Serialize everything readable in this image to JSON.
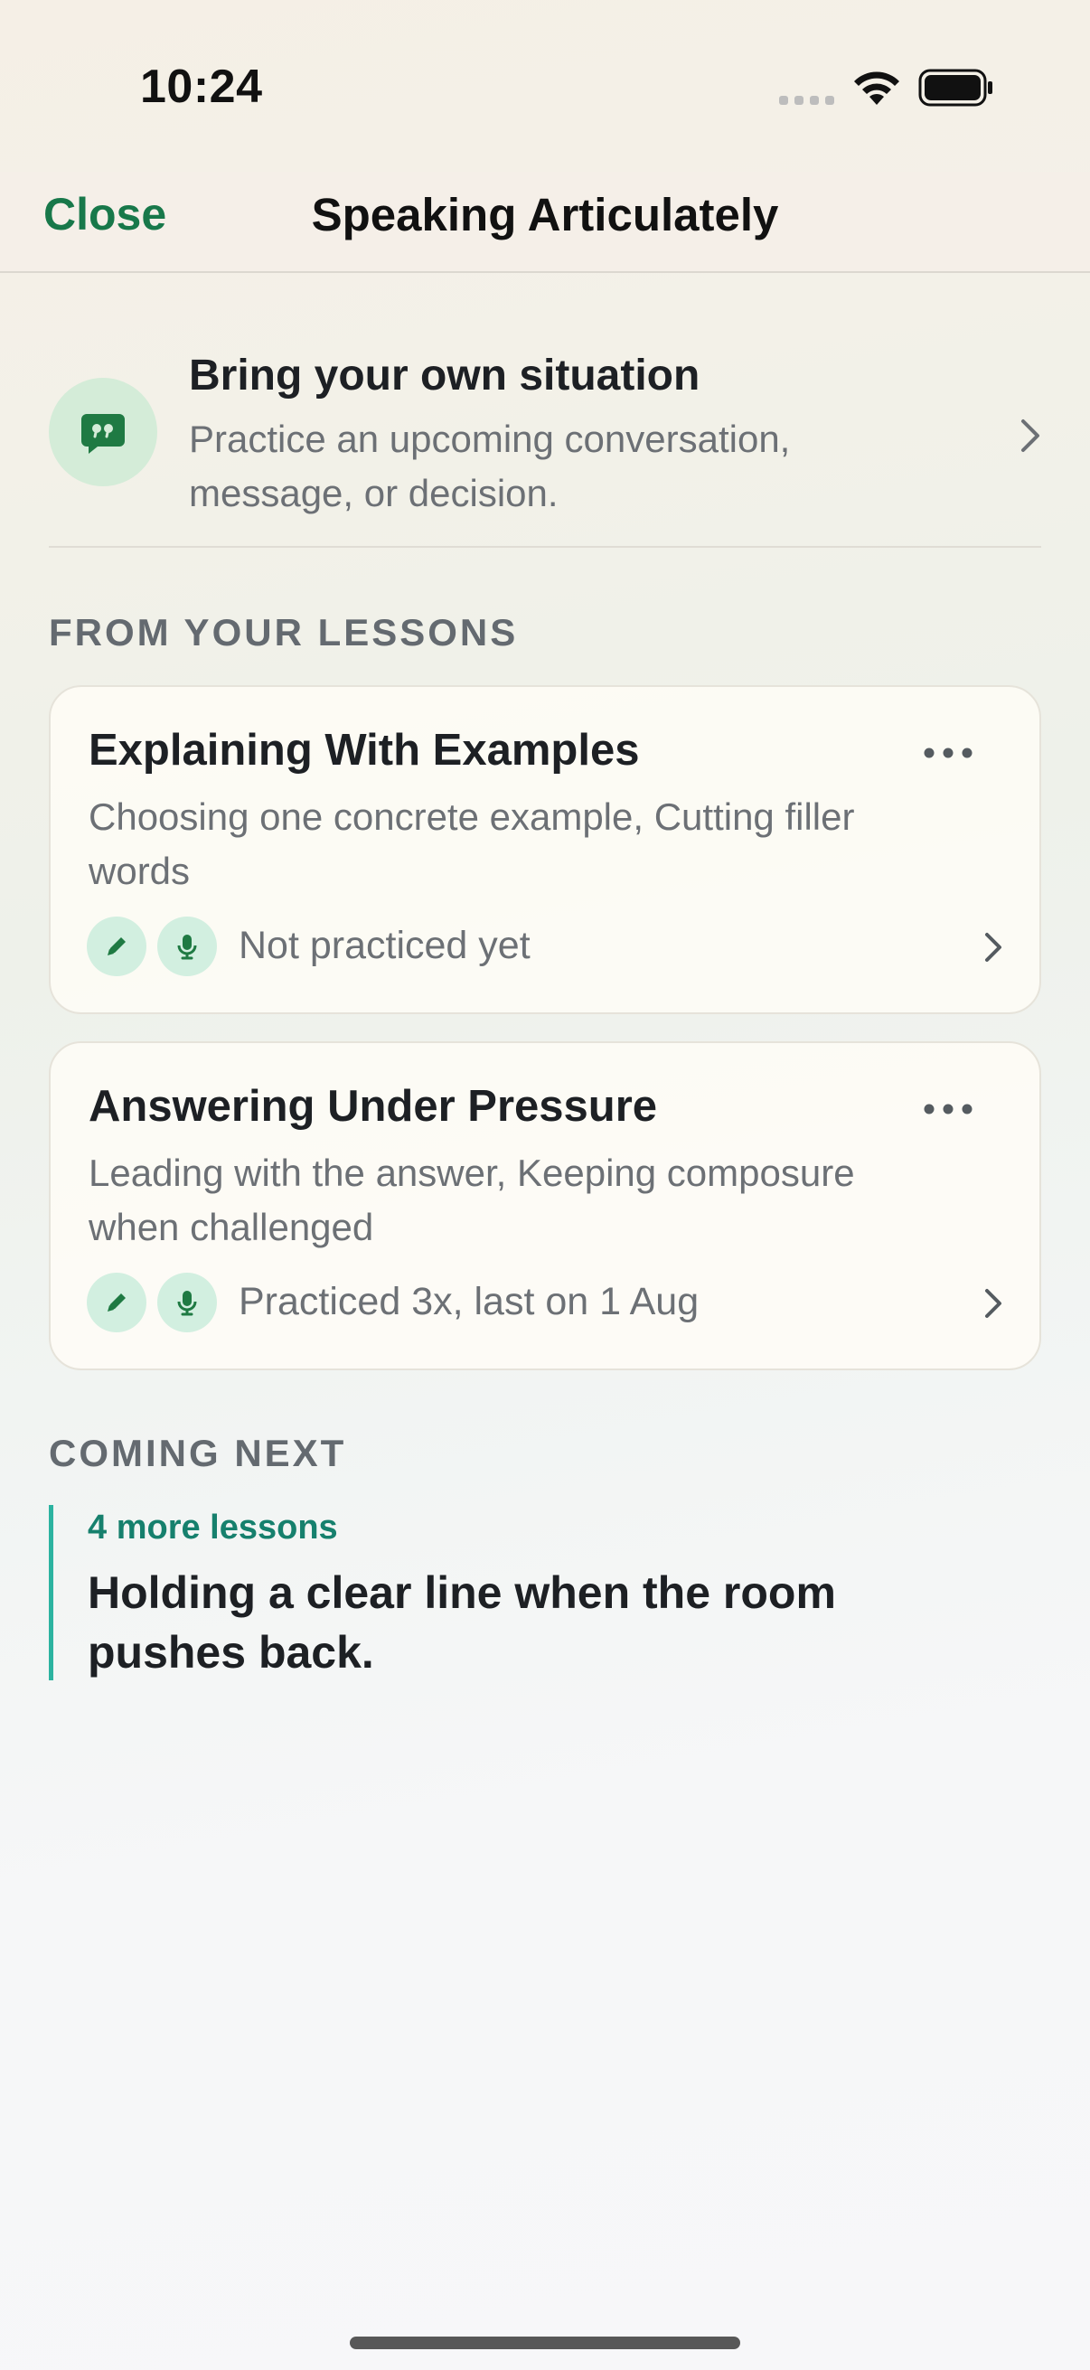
{
  "status_bar": {
    "time": "10:24"
  },
  "nav": {
    "close_label": "Close",
    "title": "Speaking Articulately"
  },
  "bring_own": {
    "title": "Bring your own situation",
    "description": "Practice an upcoming conversation, message, or decision."
  },
  "lessons_section": {
    "header": "FROM YOUR LESSONS",
    "items": [
      {
        "title": "Explaining With Examples",
        "description": "Choosing one concrete example, Cutting filler words",
        "status": "Not practiced yet"
      },
      {
        "title": "Answering Under Pressure",
        "description": "Leading with the answer, Keeping composure when challenged",
        "status": "Practiced 3x, last on 1 Aug"
      }
    ]
  },
  "coming_next": {
    "header": "COMING NEXT",
    "count": "4 more lessons",
    "text": "Holding a clear line when the room pushes back."
  },
  "colors": {
    "accent_green": "#18784a",
    "teal": "#16806d",
    "badge_bg": "#d2efe0"
  }
}
